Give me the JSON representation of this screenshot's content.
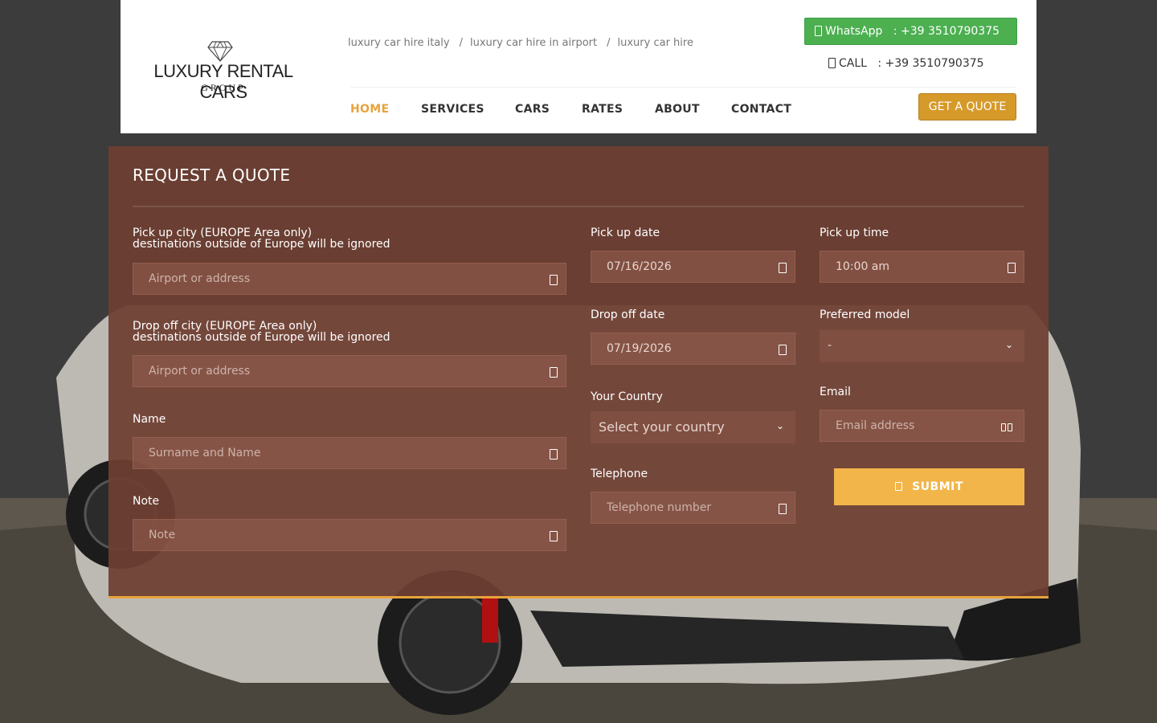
{
  "header": {
    "logo_brand": "LUXURY RENTAL CARS",
    "logo_group": "GROUP",
    "breadcrumbs": [
      "luxury car hire italy",
      "luxury car hire in airport",
      "luxury car hire"
    ],
    "whatsapp_label": "WhatsApp",
    "whatsapp_number": ": +39 3510790375",
    "call_label": "CALL",
    "call_number": ": +39 3510790375",
    "nav": [
      "HOME",
      "SERVICES",
      "CARS",
      "RATES",
      "ABOUT",
      "CONTACT"
    ],
    "active_nav": "HOME",
    "quote_button": "GET A QUOTE"
  },
  "form": {
    "title": "REQUEST A QUOTE",
    "pickup_city": {
      "label_line1": "Pick up city (EUROPE Area only)",
      "label_line2": "destinations outside of Europe will be ignored",
      "placeholder": "Airport or address"
    },
    "dropoff_city": {
      "label_line1": "Drop off city (EUROPE Area only)",
      "label_line2": "destinations outside of Europe will be ignored",
      "placeholder": "Airport or address"
    },
    "name": {
      "label": "Name",
      "placeholder": "Surname and Name"
    },
    "note": {
      "label": "Note",
      "placeholder": "Note"
    },
    "pickup_date": {
      "label": "Pick up date",
      "value": "07/16/2026"
    },
    "dropoff_date": {
      "label": "Drop off date",
      "value": "07/19/2026"
    },
    "country": {
      "label": "Your Country",
      "value": "Select your country"
    },
    "telephone": {
      "label": "Telephone",
      "placeholder": "Telephone number"
    },
    "pickup_time": {
      "label": "Pick up time",
      "value": "10:00 am"
    },
    "preferred_model": {
      "label": "Preferred model",
      "value": "-"
    },
    "email": {
      "label": "Email",
      "placeholder": "Email address"
    },
    "submit": "SUBMIT"
  },
  "colors": {
    "accent": "#e8a33d",
    "whatsapp": "#4caf50",
    "panel": "#6e3e32",
    "quote_button": "#d69a2b",
    "submit": "#f1b54a"
  }
}
